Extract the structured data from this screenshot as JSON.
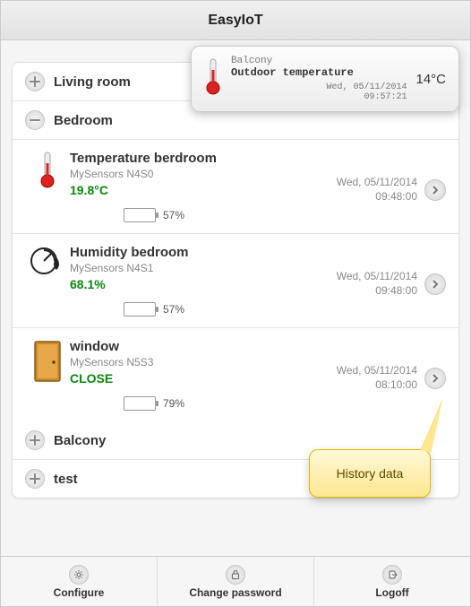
{
  "app": {
    "title": "EasyIoT"
  },
  "overlay": {
    "room": "Balcony",
    "name": "Outdoor temperature",
    "value": "14°C",
    "timestamp1": "Wed, 05/11/2014",
    "timestamp2": "09:57:21"
  },
  "groups": [
    {
      "name": "Living room",
      "expanded": false
    },
    {
      "name": "Bedroom",
      "expanded": true
    },
    {
      "name": "Balcony",
      "expanded": false
    },
    {
      "name": "test",
      "expanded": false
    }
  ],
  "bedroom_sensors": [
    {
      "icon": "thermometer",
      "name": "Temperature berdroom",
      "source": "MySensors N4S0",
      "value": "19.8°C",
      "battery_pct": 57,
      "battery_text": "57%",
      "ts1": "Wed, 05/11/2014",
      "ts2": "09:48:00"
    },
    {
      "icon": "humidity",
      "name": "Humidity bedroom",
      "source": "MySensors N4S1",
      "value": "68.1%",
      "battery_pct": 57,
      "battery_text": "57%",
      "ts1": "Wed, 05/11/2014",
      "ts2": "09:48:00"
    },
    {
      "icon": "door",
      "name": "window",
      "source": "MySensors N5S3",
      "value": "CLOSE",
      "battery_pct": 79,
      "battery_text": "79%",
      "ts1": "Wed, 05/11/2014",
      "ts2": "08:10:00"
    }
  ],
  "callout": {
    "text": "History data"
  },
  "footer": {
    "configure": "Configure",
    "change_password": "Change password",
    "logoff": "Logoff"
  }
}
